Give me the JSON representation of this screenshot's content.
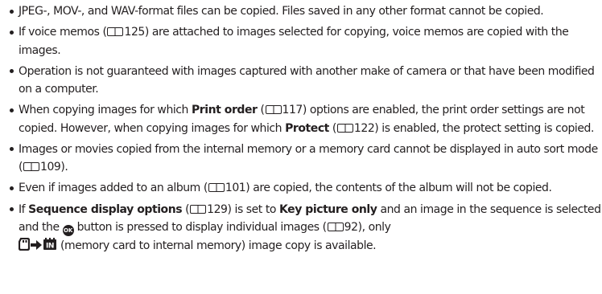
{
  "items": [
    {
      "text": "JPEG-, MOV-, and WAV-format files can be copied. Files saved in any other format cannot be copied."
    },
    {
      "a": "If voice memos (",
      "ref": "125",
      "b": ") are attached to images selected for copying, voice memos are copied with the images."
    },
    {
      "text": "Operation is not guaranteed with images captured with another make of camera or that have been modified on a computer."
    },
    {
      "a": "When copying images for which ",
      "bold1": "Print order",
      "b": " (",
      "ref1": "117",
      "c": ") options are enabled, the print order settings are not copied. However, when copying images for which ",
      "bold2": "Protect",
      "d": " (",
      "ref2": "122",
      "e": ") is enabled, the protect setting is copied."
    },
    {
      "a": "Images or movies copied from the internal memory or a memory card cannot be displayed in auto sort mode (",
      "ref": "109",
      "b": ")."
    },
    {
      "a": "Even if images added to an album (",
      "ref": "101",
      "b": ") are copied, the contents of the album will not be copied."
    },
    {
      "a": "If ",
      "bold1": "Sequence display options",
      "b": " (",
      "ref1": "129",
      "c": ") is set to ",
      "bold2": "Key picture only",
      "d": " and an image in the sequence is selected and the ",
      "ok_icon_label": "OK",
      "e": " button is pressed to display individual images (",
      "ref2": "92",
      "f": "), only",
      "g": " (memory card to internal memory) image copy is available."
    }
  ],
  "icons": {
    "reference": "book-icon",
    "ok": "ok-button-icon",
    "memory_card": "memory-card-icon",
    "arrow": "arrow-right-icon",
    "internal_memory": "internal-memory-icon"
  }
}
